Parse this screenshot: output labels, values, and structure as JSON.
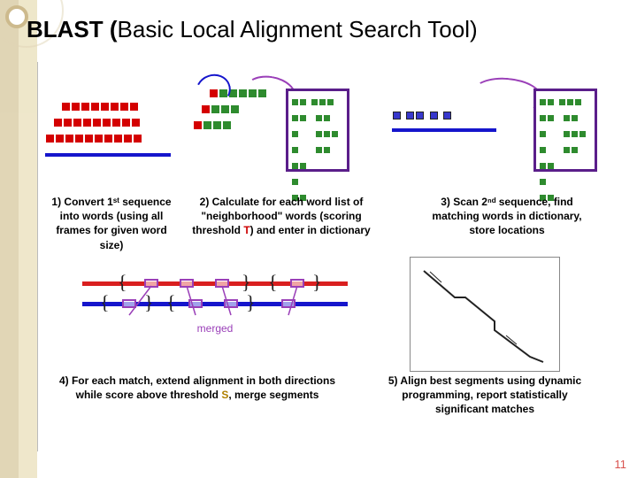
{
  "title_bold": "BLAST (",
  "title_rest": "Basic Local Alignment Search Tool)",
  "steps": {
    "s1": "1) Convert 1ˢᵗ sequence into words (using all frames for given word size)",
    "s2_a": "2) Calculate for each word list of \"neighborhood\" words (scoring threshold ",
    "s2_T": "T",
    "s2_b": ") and enter in dictionary",
    "s3": "3) Scan 2ⁿᵈ sequence, find matching words in dictionary, store locations",
    "s4_a": "4) For each match, extend alignment in both directions while score above threshold ",
    "s4_S": "S",
    "s4_b": ", merge segments",
    "s5": "5) Align best segments using dynamic programming, report statistically significant matches",
    "merged": "merged"
  },
  "page": "11"
}
